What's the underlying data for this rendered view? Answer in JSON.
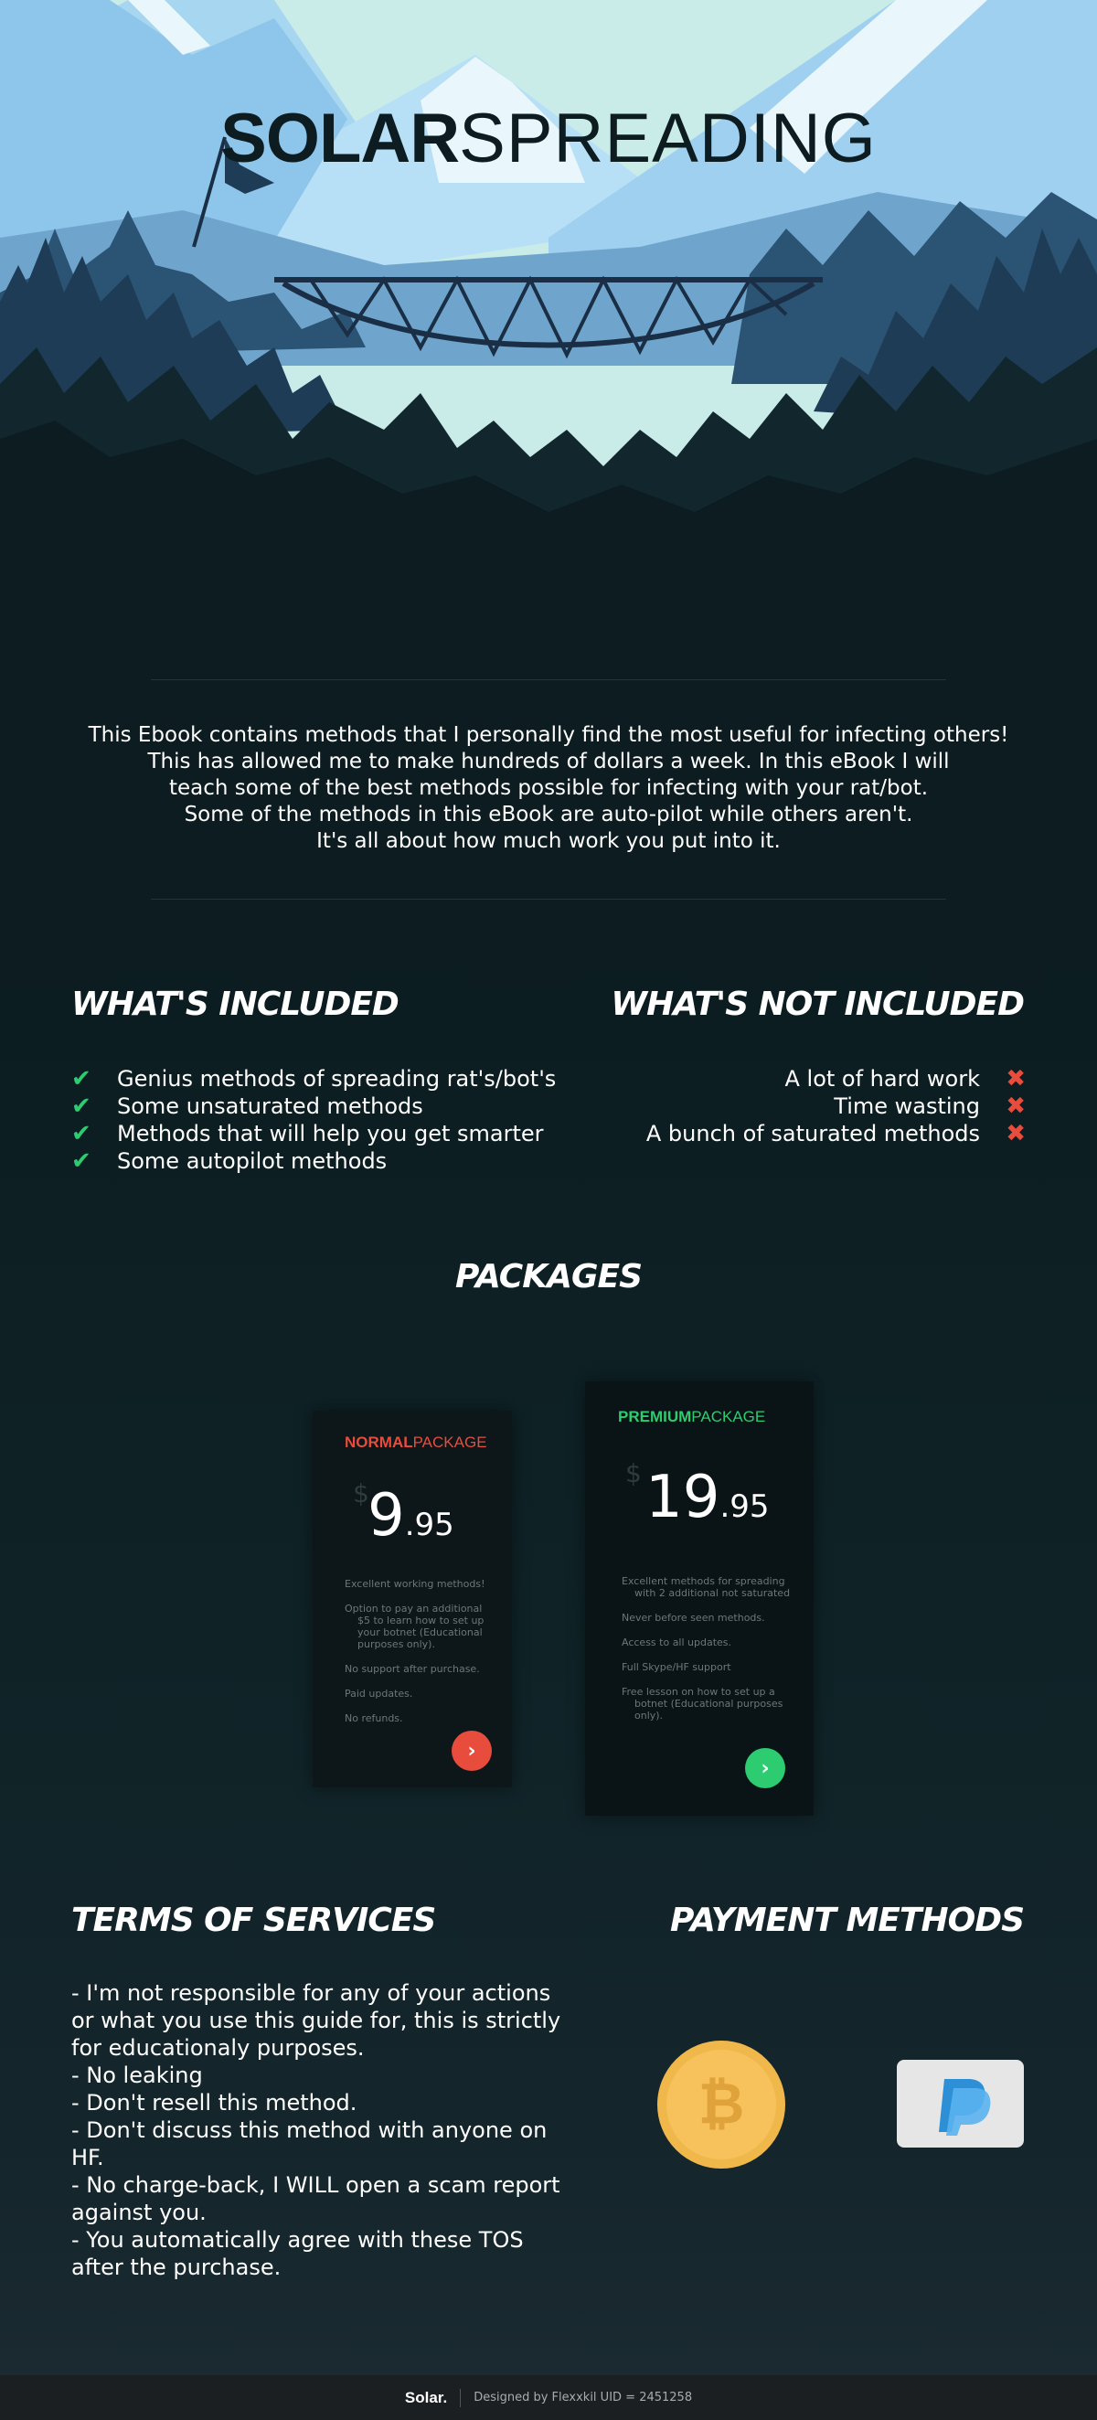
{
  "logo": {
    "bold": "SOLAR",
    "thin": "SPREADING"
  },
  "intro": {
    "lines": [
      "This Ebook contains methods that I personally find the most useful for infecting others!",
      "This has allowed me to make hundreds of dollars a week. In this eBook I will",
      "teach some of the best methods possible for infecting with your rat/bot.",
      "Some of the methods in this eBook are auto-pilot while others aren't.",
      "It's all about how much work you put into it."
    ]
  },
  "included": {
    "heading": "WHAT'S INCLUDED",
    "icon": "check-icon",
    "items": [
      "Genius methods of spreading rat's/bot's",
      "Some unsaturated methods",
      "Methods that will help you get smarter",
      "Some autopilot methods"
    ]
  },
  "not_included": {
    "heading": "WHAT'S NOT INCLUDED",
    "icon": "cross-icon",
    "items": [
      "A lot of hard work",
      "Time wasting",
      "A bunch of saturated methods"
    ]
  },
  "packages": {
    "heading": "PACKAGES",
    "normal": {
      "title_bold": "NORMAL",
      "title_thin": "PACKAGE",
      "accent": "#e74c3c",
      "currency": "$",
      "price_whole": "9",
      "price_cents": ".95",
      "features": [
        "Excellent working methods!",
        "Option to pay an additional $5 to learn how to set up your botnet (Educational purposes only).",
        "No support after purchase.",
        "Paid updates.",
        "No refunds."
      ],
      "button_icon": "chevron-right-icon"
    },
    "premium": {
      "title_bold": "PREMIUM",
      "title_thin": "PACKAGE",
      "accent": "#2ecc71",
      "currency": "$",
      "price_whole": "19",
      "price_cents": ".95",
      "features": [
        "Excellent methods for spreading with 2 additional not saturated",
        "Never before seen methods.",
        "Access to all updates.",
        "Full Skype/HF support",
        "Free lesson on how to set up a botnet (Educational purposes only)."
      ],
      "button_icon": "chevron-right-icon"
    }
  },
  "tos": {
    "heading": "TERMS OF SERVICES",
    "lines": [
      "- I'm not responsible for any of your actions or what you use this guide for, this is strictly for educationaly purposes.",
      "- No leaking",
      "- Don't resell this method.",
      "- Don't discuss this method with anyone on HF.",
      "- No charge-back, I WILL open a scam report against you.",
      "- You automatically agree with these TOS after the purchase."
    ]
  },
  "payment": {
    "heading": "PAYMENT METHODS",
    "methods": [
      "bitcoin-icon",
      "paypal-icon"
    ]
  },
  "footer": {
    "brand": "Solar.",
    "credit": "Designed by Flexxkil UID = 2451258"
  }
}
